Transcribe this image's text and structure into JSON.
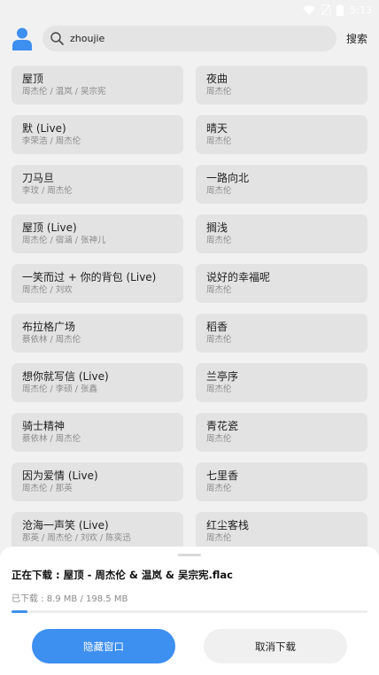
{
  "status_bar": {
    "time": "5:13"
  },
  "search": {
    "query": "zhoujie",
    "button_label": "搜索"
  },
  "songs": [
    {
      "title": "屋顶",
      "artist": "周杰伦 / 温岚 / 吴宗宪"
    },
    {
      "title": "夜曲",
      "artist": "周杰伦"
    },
    {
      "title": "默 (Live)",
      "artist": "李荣浩 / 周杰伦"
    },
    {
      "title": "晴天",
      "artist": "周杰伦"
    },
    {
      "title": "刀马旦",
      "artist": "李玟 / 周杰伦"
    },
    {
      "title": "一路向北",
      "artist": "周杰伦"
    },
    {
      "title": "屋顶 (Live)",
      "artist": "周杰伦 / 宿涵 / 张神儿"
    },
    {
      "title": "搁浅",
      "artist": "周杰伦"
    },
    {
      "title": "一笑而过 + 你的背包 (Live)",
      "artist": "周杰伦 / 刘欢"
    },
    {
      "title": "说好的幸福呢",
      "artist": "周杰伦"
    },
    {
      "title": "布拉格广场",
      "artist": "蔡依林 / 周杰伦"
    },
    {
      "title": "稻香",
      "artist": "周杰伦"
    },
    {
      "title": "想你就写信 (Live)",
      "artist": "周杰伦 / 李硕 / 张鑫"
    },
    {
      "title": "兰亭序",
      "artist": "周杰伦"
    },
    {
      "title": "骑士精神",
      "artist": "蔡依林 / 周杰伦"
    },
    {
      "title": "青花瓷",
      "artist": "周杰伦"
    },
    {
      "title": "因为爱情 (Live)",
      "artist": "周杰伦 / 那英"
    },
    {
      "title": "七里香",
      "artist": "周杰伦"
    },
    {
      "title": "沧海一声笑 (Live)",
      "artist": "那英 / 周杰伦 / 刘欢 / 陈奕迅"
    },
    {
      "title": "红尘客栈",
      "artist": "周杰伦"
    }
  ],
  "download": {
    "title": "正在下载 : 屋顶 - 周杰伦 & 温岚 & 吴宗宪.flac",
    "progress_text": "已下载 : 8.9 MB / 198.5 MB",
    "progress_fraction": 0.045,
    "hide_label": "隐藏窗口",
    "cancel_label": "取消下载"
  },
  "colors": {
    "accent": "#3d8ff0",
    "avatar": "#3d8ff0"
  }
}
